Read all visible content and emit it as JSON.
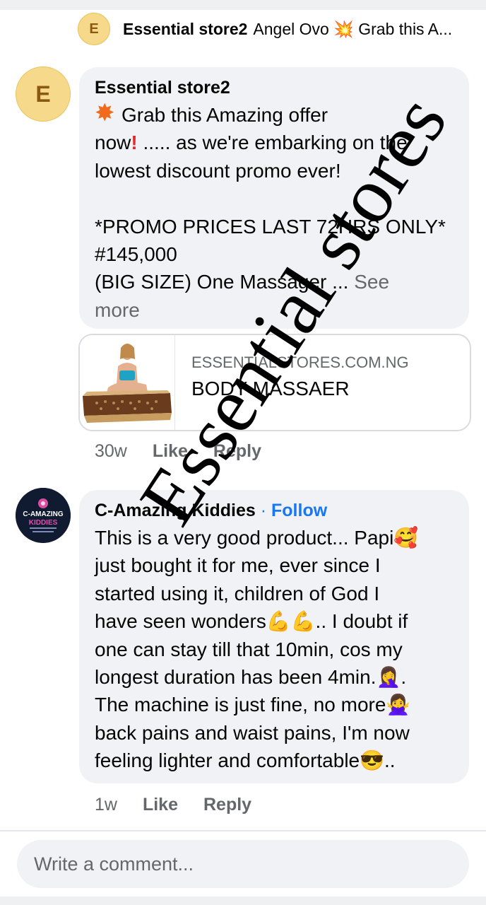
{
  "reply_preview": {
    "avatar_letter": "E",
    "author": "Essential store2",
    "text": "Angel Ovo 💥 Grab this A..."
  },
  "comment1": {
    "avatar_letter": "E",
    "author": "Essential store2",
    "lines": [
      "Grab this Amazing  offer",
      "now",
      " ..... as we're embarking on the",
      "lowest discount promo ever!",
      "",
      "*PROMO PRICES LAST 72HRS ONLY*",
      "#145,000",
      "(BIG SIZE) One Massager ... "
    ],
    "see_more_1": "See",
    "see_more_2": "more",
    "link": {
      "domain": "ESSENTIALSTORES.COM.NG",
      "title": "BODY MASSAER"
    },
    "time": "30w",
    "like": "Like",
    "reply": "Reply"
  },
  "comment2": {
    "author": "C-Amazing Kiddies",
    "follow_sep": " · ",
    "follow": "Follow",
    "lines": [
      "This is a very good product... Papi🥰",
      "just bought it for me, ever since I",
      "started using it, children of God I",
      "have seen wonders💪💪.. I doubt if",
      "one can stay till that 10min, cos my",
      "longest duration has been 4min.🤦‍♀️.",
      "The machine is just fine, no more🙅‍♀️",
      "back pains and waist pains, I'm now",
      "feeling lighter and comfortable😎.."
    ],
    "avatar_text": "C-AMAZING KIDDIES",
    "time": "1w",
    "like": "Like",
    "reply": "Reply"
  },
  "composer": {
    "placeholder": "Write a comment..."
  },
  "watermark": "Essential stores"
}
